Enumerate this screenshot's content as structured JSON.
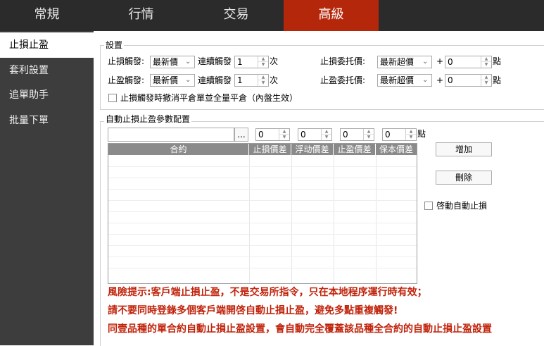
{
  "tabs": [
    {
      "label": "常規"
    },
    {
      "label": "行情"
    },
    {
      "label": "交易"
    },
    {
      "label": "高級"
    }
  ],
  "active_tab": "高級",
  "sidebar": {
    "items": [
      {
        "label": "止損止盈"
      },
      {
        "label": "套利設置"
      },
      {
        "label": "追單助手"
      },
      {
        "label": "批量下單"
      }
    ]
  },
  "settings": {
    "title": "設置",
    "stoploss_trigger_label": "止損觸發:",
    "stoploss_trigger_value": "最新價",
    "takeprofit_trigger_label": "止盈觸發:",
    "takeprofit_trigger_value": "最新價",
    "consecutive_label": "連續觸發",
    "consecutive_sl_value": "1",
    "consecutive_tp_value": "1",
    "times_unit": "次",
    "sl_order_price_label": "止損委托價:",
    "sl_order_price_value": "最新超價",
    "tp_order_price_label": "止盈委托價:",
    "tp_order_price_value": "最新超價",
    "plus": "+",
    "sl_points_value": "0",
    "tp_points_value": "0",
    "points_unit": "點",
    "cancel_checkbox_label": "止損觸發時撤消平倉單並全量平倉（內盤生效）"
  },
  "auto_config": {
    "title": "自動止損止盈參數配置",
    "contract_input_value": "",
    "browse_label": "...",
    "spin_values": [
      "0",
      "0",
      "0",
      "0"
    ],
    "points_unit": "點",
    "columns": [
      "合約",
      "止損價差",
      "浮动價差",
      "止盈價差",
      "保本價差"
    ],
    "add_button": "增加",
    "delete_button": "刪除",
    "enable_auto_label": "啓動自動止損"
  },
  "warnings": [
    "風險提示:客戶端止損止盈，不是交易所指令，只在本地程序運行時有效；",
    "請不要同時登錄多個客戶端開啓自動止損止盈，避免多點重複觸發!",
    "同壹品種的單合約自動止損止盈設置，會自動完全覆蓋該品種全合約的自動止損止盈設置"
  ],
  "colors": {
    "accent": "#b5270b",
    "topbar": "#2b2b2b",
    "sidebar": "#3d3d3d",
    "warning_text": "#c0230b"
  }
}
